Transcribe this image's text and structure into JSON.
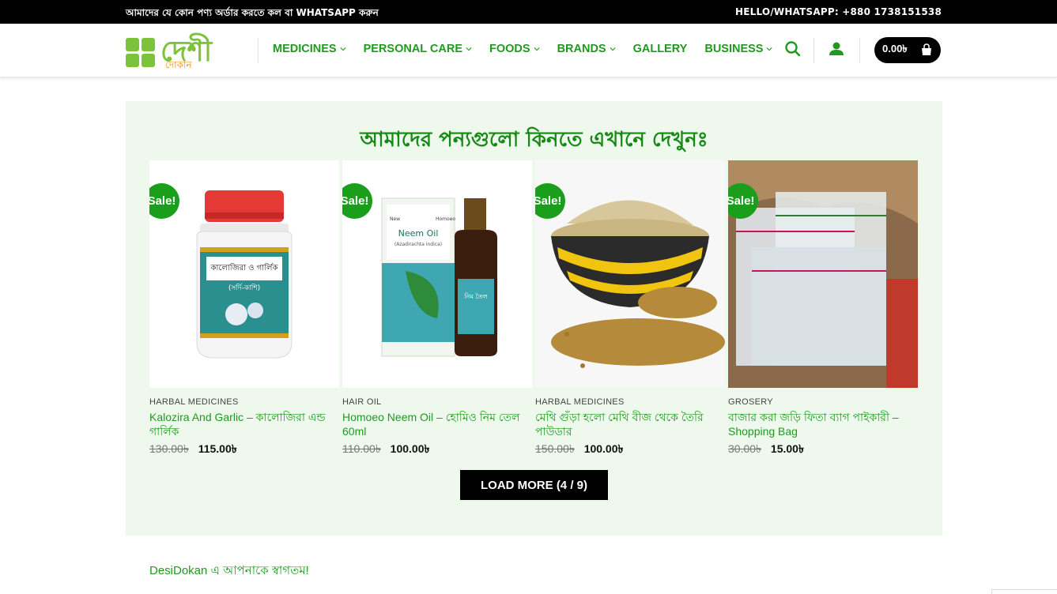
{
  "topbar": {
    "left_text": "আমাদের যে কোন পণ্য অর্ডার করতে কল বা WHATSAPP করুন",
    "right_text": "HELLO/WHATSAPP: +880 1738151538"
  },
  "logo": {
    "word": "দেশী",
    "sub": "দোকান"
  },
  "nav": [
    {
      "label": "MEDICINES",
      "dropdown": true
    },
    {
      "label": "PERSONAL CARE",
      "dropdown": true
    },
    {
      "label": "FOODS",
      "dropdown": true
    },
    {
      "label": "BRANDS",
      "dropdown": true
    },
    {
      "label": "GALLERY",
      "dropdown": false
    },
    {
      "label": "BUSINESS",
      "dropdown": true
    }
  ],
  "cart": {
    "total": "0.00৳"
  },
  "section": {
    "title": "আমাদের পন্যগুলো কিনতে এখানে দেখুনঃ",
    "load_more": "LOAD MORE (4 / 9)"
  },
  "products": [
    {
      "badge": "Sale!",
      "category": "HARBAL MEDICINES",
      "title": "Kalozira And Garlic – কালোজিরা এন্ড গার্লিক",
      "old_price": "130.00৳",
      "new_price": "115.00৳"
    },
    {
      "badge": "Sale!",
      "category": "HAIR OIL",
      "title": "Homoeo Neem Oil – হোমিও নিম তেল 60ml",
      "old_price": "110.00৳",
      "new_price": "100.00৳"
    },
    {
      "badge": "Sale!",
      "category": "HARBAL MEDICINES",
      "title": "মেথি গুঁড়া হলো মেথি বীজ থেকে তৈরি পাউডার",
      "old_price": "150.00৳",
      "new_price": "100.00৳"
    },
    {
      "badge": "Sale!",
      "category": "GROSERY",
      "title": "বাজার করা জড়ি ফিতা ব্যাগ পাইকারী – Shopping Bag",
      "old_price": "30.00৳",
      "new_price": "15.00৳"
    }
  ],
  "product_images": {
    "jar_label": "কালোজিরা ও গার্লিক",
    "jar_sub": "(সর্দি-কাশি)",
    "box_brand": "Neem Oil",
    "box_sub": "(Azadirachta indica)",
    "box_top_left": "New",
    "box_top_right": "Homoeo",
    "bottle_label": "নিম তৈল"
  },
  "welcome": "DesiDokan এ আপনাকে স্বাগতম!",
  "colors": {
    "brand_green": "#1f9a1f",
    "logo_green": "#7cc23a",
    "logo_orange": "#f08a00",
    "section_bg": "#eef8ec"
  }
}
